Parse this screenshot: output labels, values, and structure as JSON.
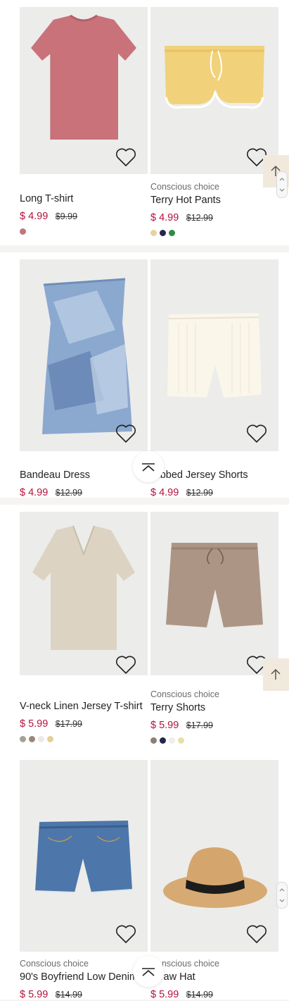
{
  "products": [
    {
      "id": "p1",
      "badge": "",
      "title": "Long T-shirt",
      "price": "$ 4.99",
      "old_price": "$9.99",
      "swatches": [
        "#c4747c"
      ]
    },
    {
      "id": "p2",
      "badge": "Conscious choice",
      "title": "Terry Hot Pants",
      "price": "$ 4.99",
      "old_price": "$12.99",
      "swatches": [
        "#e8d29a",
        "#23284a",
        "#2f8a43"
      ]
    },
    {
      "id": "p3",
      "badge": "",
      "title": "Bandeau Dress",
      "price": "$ 4.99",
      "old_price": "$12.99",
      "swatches": []
    },
    {
      "id": "p4",
      "badge": "",
      "title": "Ribbed Jersey Shorts",
      "price": "$ 4.99",
      "old_price": "$12.99",
      "swatches": []
    },
    {
      "id": "p5",
      "badge": "",
      "title": "V-neck Linen Jersey T-shirt",
      "price": "$ 5.99",
      "old_price": "$17.99",
      "swatches": [
        "#a8a096",
        "#9b8677",
        "#ede8e4",
        "#e6cf97"
      ]
    },
    {
      "id": "p6",
      "badge": "Conscious choice",
      "title": "Terry Shorts",
      "price": "$ 5.99",
      "old_price": "$17.99",
      "swatches": [
        "#8c7f72",
        "#23284a",
        "#efeeea",
        "#e8dfa6"
      ]
    },
    {
      "id": "p7",
      "badge": "Conscious choice",
      "title": "90's Boyfriend Low Denim",
      "price": "$ 5.99",
      "old_price": "$14.99",
      "swatches": []
    },
    {
      "id": "p8",
      "badge": "Conscious choice",
      "title": "Straw Hat",
      "price": "$ 5.99",
      "old_price": "$14.99",
      "swatches": []
    }
  ],
  "icons": {
    "favorite": "heart-icon",
    "back_to_top": "chevron-up-icon",
    "side_tab": "arrow-up-icon"
  },
  "colors": {
    "sale_price": "#b5113e",
    "image_bg": "#ececea",
    "page_bg": "#f5f4f2",
    "side_tab_bg": "#f1e9dc"
  }
}
